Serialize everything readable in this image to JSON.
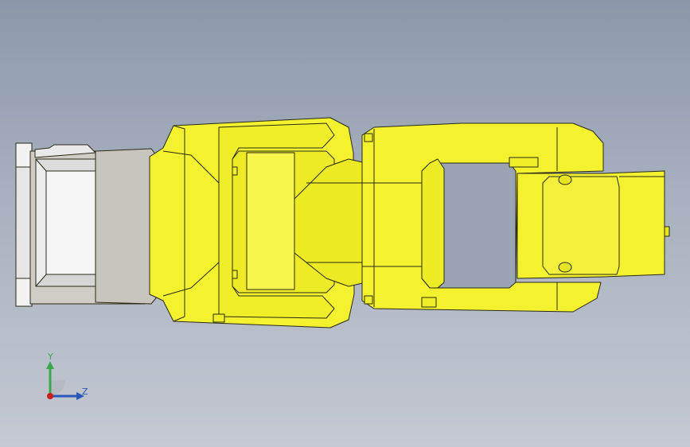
{
  "viewport": {
    "background_top": "#8c98a9",
    "background_bottom": "#c4c9d2"
  },
  "model": {
    "component_color": "#f4f22e",
    "edge_color": "#2a2a16",
    "base_color": "#ededed",
    "motor_color": "#bdbab4"
  },
  "triad": {
    "y_label": "Y",
    "z_label": "Z",
    "y_color": "#3aa84a",
    "z_color": "#2a58b8",
    "x_color": "#d01a1a"
  }
}
